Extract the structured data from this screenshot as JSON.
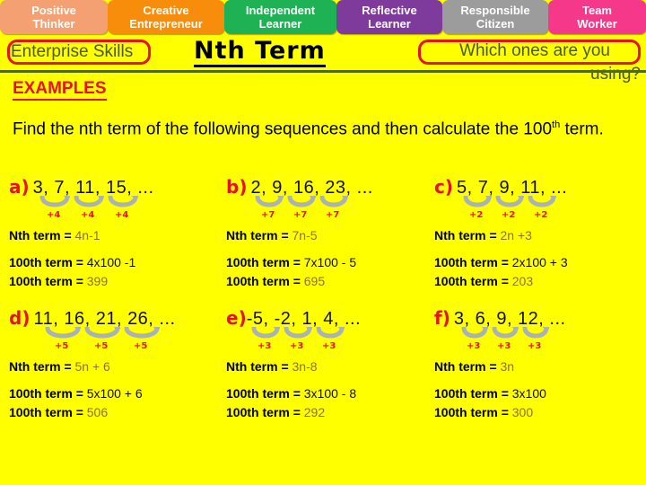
{
  "tabs": [
    {
      "line1": "Positive",
      "line2": "Thinker",
      "color": "#F4A072"
    },
    {
      "line1": "Creative",
      "line2": "Entrepreneur",
      "color": "#F78D0B"
    },
    {
      "line1": "Independent",
      "line2": "Learner",
      "color": "#1EB254"
    },
    {
      "line1": "Reflective",
      "line2": "Learner",
      "color": "#7E3B9B"
    },
    {
      "line1": "Responsible",
      "line2": "Citizen",
      "color": "#9C9C9C"
    },
    {
      "line1": "Team",
      "line2": "Worker",
      "color": "#F6388A"
    }
  ],
  "header": {
    "enterprise_skills": "Enterprise Skills",
    "title": "Nth Term",
    "question_line1": "Which ones are you",
    "question_line2": "using?",
    "examples": "EXAMPLES",
    "intro_part1": "Find the nth term of the following sequences and then calculate the 100",
    "intro_sup": "th",
    "intro_part2": " term."
  },
  "colors": {
    "background": "#FFFF00",
    "accent_red": "#E81123",
    "rule_green": "#4F6B14",
    "value_olive": "#8A7230",
    "arc_gray": "#A9B2B8"
  },
  "labels": {
    "nth_term": "Nth term =",
    "hundredth_term": "100th term ="
  },
  "problems": [
    {
      "id": "a",
      "label": "a)",
      "sequence": "3, 7, 11, 15, ...",
      "terms": [
        3,
        7,
        11,
        15
      ],
      "difference": "+4",
      "diffs": [
        "+4",
        "+4",
        "+4"
      ],
      "nth_term": "4n-1",
      "calc": "4x100 -1",
      "result": "399"
    },
    {
      "id": "b",
      "label": "b)",
      "sequence": "2, 9, 16, 23, ...",
      "terms": [
        2,
        9,
        16,
        23
      ],
      "difference": "+7",
      "diffs": [
        "+7",
        "+7",
        "+7"
      ],
      "nth_term": "7n-5",
      "calc": "7x100 - 5",
      "result": "695"
    },
    {
      "id": "c",
      "label": "c)",
      "sequence": "5, 7, 9, 11, ...",
      "terms": [
        5,
        7,
        9,
        11
      ],
      "difference": "+2",
      "diffs": [
        "+2",
        "+2",
        "+2"
      ],
      "nth_term": "2n +3",
      "calc": "2x100 + 3",
      "result": "203"
    },
    {
      "id": "d",
      "label": "d)",
      "sequence": "11, 16, 21, 26, ...",
      "terms": [
        11,
        16,
        21,
        26
      ],
      "difference": "+5",
      "diffs": [
        "+5",
        "+5",
        "+5"
      ],
      "nth_term": "5n + 6",
      "calc": "5x100 + 6",
      "result": "506"
    },
    {
      "id": "e",
      "label": "e)",
      "sequence": "-5, -2, 1, 4, ...",
      "terms": [
        -5,
        -2,
        1,
        4
      ],
      "difference": "+3",
      "diffs": [
        "+3",
        "+3",
        "+3"
      ],
      "nth_term": "3n-8",
      "calc": "3x100 - 8",
      "result": "292"
    },
    {
      "id": "f",
      "label": "f)",
      "sequence": "3, 6, 9, 12, ...",
      "terms": [
        3,
        6,
        9,
        12
      ],
      "difference": "+3",
      "diffs": [
        "+3",
        "+3",
        "+3"
      ],
      "nth_term": "3n",
      "calc": "3x100",
      "result": "300"
    }
  ]
}
